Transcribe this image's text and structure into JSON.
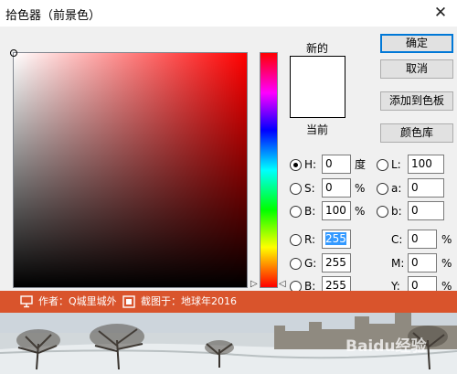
{
  "window": {
    "title": "拾色器（前景色）",
    "close_label": "✕"
  },
  "preview": {
    "new_label": "新的",
    "current_label": "当前",
    "new_color": "#ffffff"
  },
  "buttons": {
    "ok": "确定",
    "cancel": "取消",
    "add_to_swatches": "添加到色板",
    "color_libraries": "颜色库"
  },
  "hsb": {
    "h": {
      "label": "H:",
      "value": "0",
      "unit": "度",
      "selected": true
    },
    "s": {
      "label": "S:",
      "value": "0",
      "unit": "%"
    },
    "b": {
      "label": "B:",
      "value": "100",
      "unit": "%"
    }
  },
  "lab": {
    "l": {
      "label": "L:",
      "value": "100"
    },
    "a": {
      "label": "a:",
      "value": "0"
    },
    "b": {
      "label": "b:",
      "value": "0"
    }
  },
  "rgb": {
    "r": {
      "label": "R:",
      "value": "255"
    },
    "g": {
      "label": "G:",
      "value": "255"
    },
    "b": {
      "label": "B:",
      "value": "255"
    }
  },
  "cmyk": {
    "c": {
      "label": "C:",
      "value": "0",
      "unit": "%"
    },
    "m": {
      "label": "M:",
      "value": "0",
      "unit": "%"
    },
    "y": {
      "label": "Y:",
      "value": "0",
      "unit": "%"
    }
  },
  "watermark": {
    "author": "作者：Q城里城外",
    "credit": "截图于：地球年2016",
    "brand": "Baidu经验"
  },
  "colors": {
    "hue": "#ff0000",
    "accent": "#d9542c",
    "selection": "#3399ff"
  }
}
